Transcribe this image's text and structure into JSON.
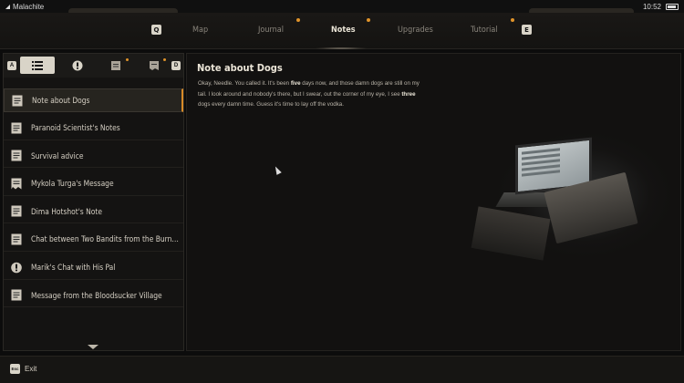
{
  "status": {
    "carrier": "Malachite",
    "time": "10:52"
  },
  "nav": {
    "left_key": "Q",
    "right_key": "E",
    "tabs": [
      {
        "label": "Map"
      },
      {
        "label": "Journal"
      },
      {
        "label": "Notes"
      },
      {
        "label": "Upgrades"
      },
      {
        "label": "Tutorial"
      }
    ],
    "active_tab": "Notes"
  },
  "filters": {
    "left_key": "A",
    "right_key": "D"
  },
  "notes": [
    {
      "label": "Note about Dogs",
      "icon": "note-icon",
      "selected": true
    },
    {
      "label": "Paranoid Scientist's Notes",
      "icon": "note-icon"
    },
    {
      "label": "Survival advice",
      "icon": "note-icon"
    },
    {
      "label": "Mykola Turga's Message",
      "icon": "torn-note-icon"
    },
    {
      "label": "Dima Hotshot's Note",
      "icon": "note-icon"
    },
    {
      "label": "Chat between Two Bandits from the Burnt...",
      "icon": "note-icon"
    },
    {
      "label": "Marik's Chat with His Pal",
      "icon": "alert-icon"
    },
    {
      "label": "Message from the Bloodsucker Village",
      "icon": "note-icon"
    }
  ],
  "note": {
    "title": "Note about Dogs",
    "body_1": "Okay, Needle. You called it. It's been ",
    "body_bold_1": "five",
    "body_2": " days now, and those damn dogs are still on my tail. I look around and nobody's there, but I swear, out the corner of my eye, I see ",
    "body_bold_2": "three",
    "body_3": " dogs every damn time. Guess it's time to lay off the vodka."
  },
  "footer": {
    "key": "Esc",
    "label": "Exit"
  },
  "colors": {
    "accent": "#d88a27",
    "notification_dot": "#e0932a"
  }
}
